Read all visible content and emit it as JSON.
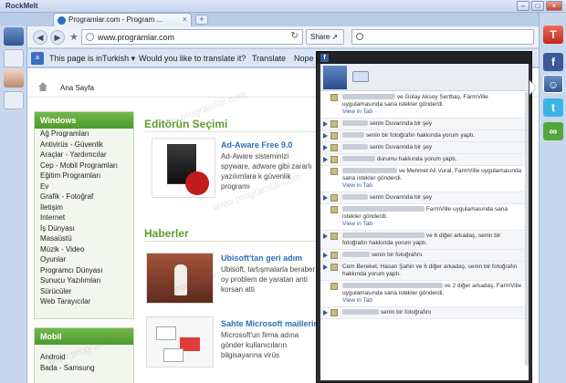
{
  "window": {
    "app_title": "RockMelt"
  },
  "tabs": [
    {
      "title": "Programlar.com - Program ..."
    }
  ],
  "toolbar": {
    "url": "www.programlar.com",
    "share_label": "Share"
  },
  "translate_bar": {
    "prefix": "This page is in",
    "language": "Turkish",
    "question": "Would you like to translate it?",
    "translate_label": "Translate",
    "nope_label": "Nope"
  },
  "page": {
    "breadcrumb": "Ana Sayfa",
    "windows_box": {
      "title": "Windows",
      "categories": [
        "Ağ Programları",
        "Antivirüs - Güvenlik",
        "Araçlar - Yardımcılar",
        "Cep - Mobil Programları",
        "Eğitim Programları",
        "Ev",
        "Grafik - Fotoğraf",
        "İletişim",
        "Internet",
        "İş Dünyası",
        "Masaüstü",
        "Müzik - Video",
        "Oyunlar",
        "Programcı Dünyası",
        "Sunucu Yazılımları",
        "Sürücüler",
        "Web Tarayıcılar"
      ]
    },
    "mobil_box": {
      "title": "Mobil",
      "categories": [
        "Android",
        "Bada - Samsung"
      ]
    },
    "editor_section": {
      "title": "Editörün Seçimi",
      "article": {
        "title": "Ad-Aware Free 9.0",
        "text": "Ad-Aware sisteminizi spyware, adware gibi zararlı yazılımlara k güvenlik programı"
      }
    },
    "news_section": {
      "title": "Haberler",
      "articles": [
        {
          "title": "Ubisoft'tan geri adım",
          "text": "Ubisoft, tartışmalarla beraber oy problem de yaratan anti korsan atti"
        },
        {
          "title": "Sahte Microsoft maillerin",
          "text": "Microsoft'un firma adına gönder kullanıcıların bilgisayarına virüs"
        }
      ]
    },
    "watermark": "www.programlar.com"
  },
  "facebook_panel": {
    "logo": "f",
    "feed": [
      {
        "text": "ve Gülay Aksoy Sertbaş, FarmVille uygulamasında sana istekler gönderdi.",
        "blur_w": 58,
        "view_in_tab": "View in Tab",
        "plain": true,
        "arrow": false
      },
      {
        "text": "senin Duvarında bir şey",
        "blur_w": 28,
        "view_in_tab": "",
        "plain": false,
        "arrow": true
      },
      {
        "text": "senin bir fotoğrafın hakkında yorum yaptı.",
        "blur_w": 24,
        "view_in_tab": "",
        "plain": false,
        "arrow": true
      },
      {
        "text": "senin Duvarında bir şey",
        "blur_w": 28,
        "view_in_tab": "",
        "plain": false,
        "arrow": true
      },
      {
        "text": "durumu hakkında yorum yaptı.",
        "blur_w": 36,
        "view_in_tab": "",
        "plain": false,
        "arrow": true
      },
      {
        "text": "ve Mehmet Ali Vural, FarmVille uygulamasında sana istekler gönderdi.",
        "blur_w": 60,
        "view_in_tab": "View in Tab",
        "plain": true,
        "arrow": false
      },
      {
        "text": "senin Duvarında bir şey",
        "blur_w": 28,
        "view_in_tab": "",
        "plain": false,
        "arrow": true
      },
      {
        "text": "FarmVille uygulamasında sana istekler gönderdi.",
        "blur_w": 90,
        "view_in_tab": "View in Tab",
        "plain": true,
        "arrow": false
      },
      {
        "text": "ve 6 diğer arkadaş, senin bir fotoğrafın hakkında yorum yaptı.",
        "blur_w": 90,
        "view_in_tab": "",
        "plain": false,
        "arrow": true
      },
      {
        "text": "senin bir fotoğrafını",
        "blur_w": 30,
        "view_in_tab": "",
        "plain": false,
        "arrow": true
      },
      {
        "text": "Cem Bereket, Hasan Şahin ve 6 diğer arkadaş, senin bir fotoğrafın hakkında yorum yaptı.",
        "blur_w": 0,
        "view_in_tab": "",
        "plain": false,
        "arrow": true
      },
      {
        "text": "ve 2 diğer arkadaş, FarmVille uygulamasında sana istekler gönderdi.",
        "blur_w": 110,
        "view_in_tab": "View in Tab",
        "plain": true,
        "arrow": false
      },
      {
        "text": "senin bir fotoğrafını",
        "blur_w": 40,
        "view_in_tab": "",
        "plain": false,
        "arrow": true
      }
    ]
  },
  "right_dock": [
    "facebook-icon",
    "contacts-icon",
    "twitter-icon",
    "chat-icon"
  ]
}
